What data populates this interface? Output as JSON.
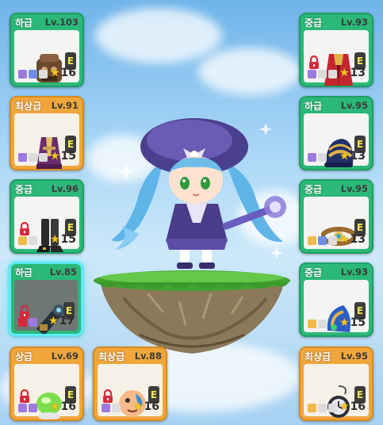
{
  "screen": "character-equipment-showcase",
  "colors": {
    "card_green": "#2bb878",
    "card_orange": "#f0a63a",
    "selected_glow": "#58ecf7",
    "star": "#f7c51d",
    "lock_red": "#d8283a"
  },
  "slots": [
    {
      "grade": "하급",
      "level": "Lv.103",
      "stars": "16",
      "icon": "chest-armor-icon",
      "locked": false,
      "badge": "E"
    },
    {
      "grade": "최상급",
      "level": "Lv.91",
      "stars": "15",
      "icon": "purple-robe-icon",
      "locked": false,
      "badge": "E"
    },
    {
      "grade": "중급",
      "level": "Lv.96",
      "stars": "15",
      "icon": "black-boots-icon",
      "locked": true,
      "badge": "E"
    },
    {
      "grade": "하급",
      "level": "Lv.85",
      "stars": "17",
      "icon": "arm-cannon-icon",
      "locked": true,
      "badge": "E"
    },
    {
      "grade": "상급",
      "level": "Lv.69",
      "stars": "16",
      "icon": "green-orb-icon",
      "locked": true,
      "badge": "E"
    },
    {
      "grade": "최상급",
      "level": "Lv.88",
      "stars": "16",
      "icon": "face-accessory-icon",
      "locked": true,
      "badge": "E"
    },
    {
      "grade": "중급",
      "level": "Lv.93",
      "stars": "13",
      "icon": "red-cape-icon",
      "locked": true,
      "badge": "E"
    },
    {
      "grade": "하급",
      "level": "Lv.95",
      "stars": "13",
      "icon": "striped-hat-icon",
      "locked": false,
      "badge": "E"
    },
    {
      "grade": "중급",
      "level": "Lv.95",
      "stars": "13",
      "icon": "gold-belt-icon",
      "locked": false,
      "badge": "E"
    },
    {
      "grade": "중급",
      "level": "Lv.93",
      "stars": "15",
      "icon": "blue-shoulder-icon",
      "locked": false,
      "badge": "E"
    },
    {
      "grade": "최상급",
      "level": "Lv.95",
      "stars": "16",
      "icon": "pocket-watch-icon",
      "locked": false,
      "badge": "E"
    }
  ]
}
